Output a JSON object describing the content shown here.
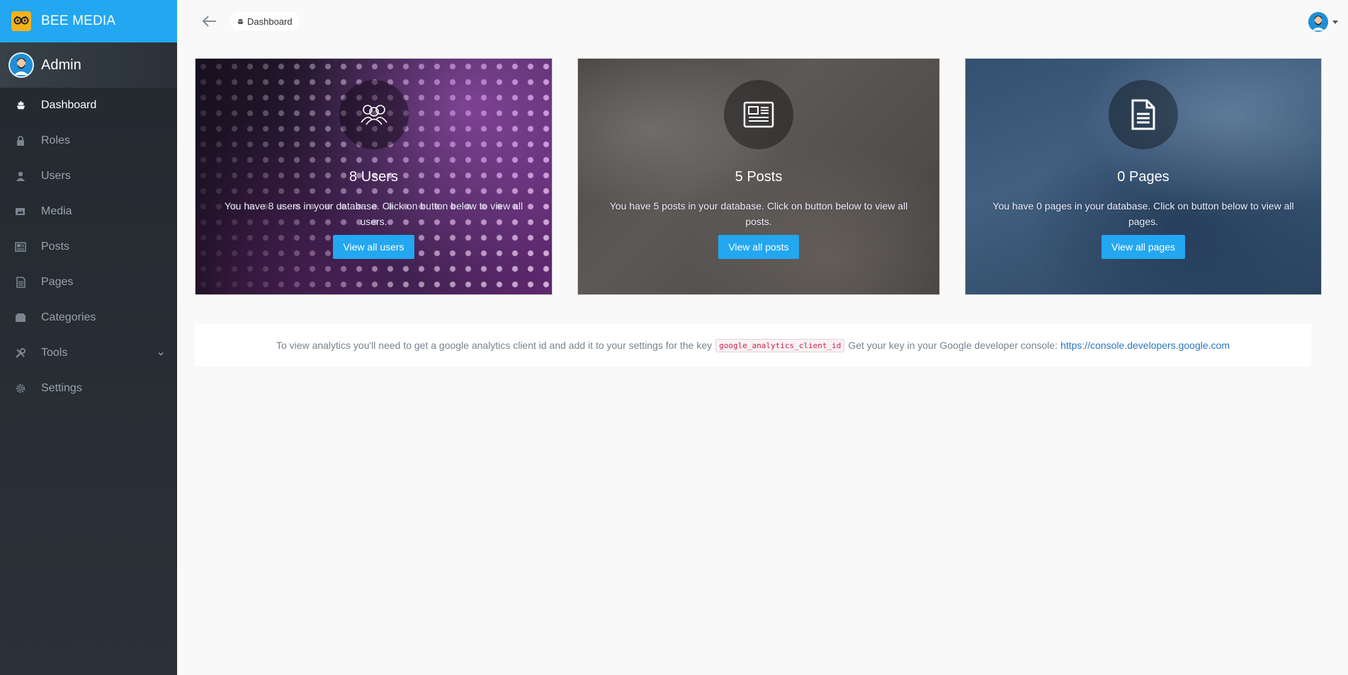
{
  "brand": {
    "title": "BEE MEDIA",
    "color": "#22a7f0"
  },
  "profile": {
    "name": "Admin"
  },
  "sidebar": {
    "items": [
      {
        "label": "Dashboard",
        "icon": "boat-icon",
        "active": true
      },
      {
        "label": "Roles",
        "icon": "lock-icon"
      },
      {
        "label": "Users",
        "icon": "person-icon"
      },
      {
        "label": "Media",
        "icon": "images-icon"
      },
      {
        "label": "Posts",
        "icon": "news-icon"
      },
      {
        "label": "Pages",
        "icon": "file-text-icon"
      },
      {
        "label": "Categories",
        "icon": "categories-icon"
      },
      {
        "label": "Tools",
        "icon": "tools-icon",
        "has_submenu": true
      },
      {
        "label": "Settings",
        "icon": "gear-icon"
      }
    ]
  },
  "topbar": {
    "breadcrumb": "Dashboard"
  },
  "cards": [
    {
      "title": "8 Users",
      "text": "You have 8 users in your database. Click on button below to view all users.",
      "button": "View all users",
      "icon": "group-icon"
    },
    {
      "title": "5 Posts",
      "text": "You have 5 posts in your database. Click on button below to view all posts.",
      "button": "View all posts",
      "icon": "newspaper-icon"
    },
    {
      "title": "0 Pages",
      "text": "You have 0 pages in your database. Click on button below to view all pages.",
      "button": "View all pages",
      "icon": "document-icon"
    }
  ],
  "analytics": {
    "text_before": "To view analytics you'll need to get a google analytics client id and add it to your settings for the key",
    "key": "google_analytics_client_id",
    "text_after": "Get your key in your Google developer console:",
    "link": "https://console.developers.google.com"
  }
}
